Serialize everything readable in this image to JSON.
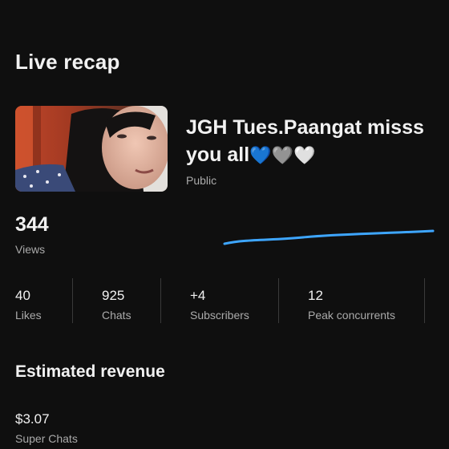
{
  "page_title": "Live recap",
  "stream": {
    "title_text": "JGH Tues.Paangat misss you all",
    "hearts": [
      "💙",
      "🩶",
      "🤍"
    ],
    "visibility": "Public",
    "thumbnail_icon": "video-thumbnail"
  },
  "views": {
    "value": "344",
    "label": "Views",
    "trend_color": "#3ea6ff"
  },
  "stats": [
    {
      "value": "40",
      "label": "Likes"
    },
    {
      "value": "925",
      "label": "Chats"
    },
    {
      "value": "+4",
      "label": "Subscribers"
    },
    {
      "value": "12",
      "label": "Peak concurrents"
    }
  ],
  "revenue": {
    "section_title": "Estimated revenue",
    "value": "$3.07",
    "label": "Super Chats"
  },
  "colors": {
    "background": "#0f0f0f",
    "primary_text": "#f1f1f1",
    "secondary_text": "#aaaaaa",
    "accent": "#3ea6ff"
  }
}
